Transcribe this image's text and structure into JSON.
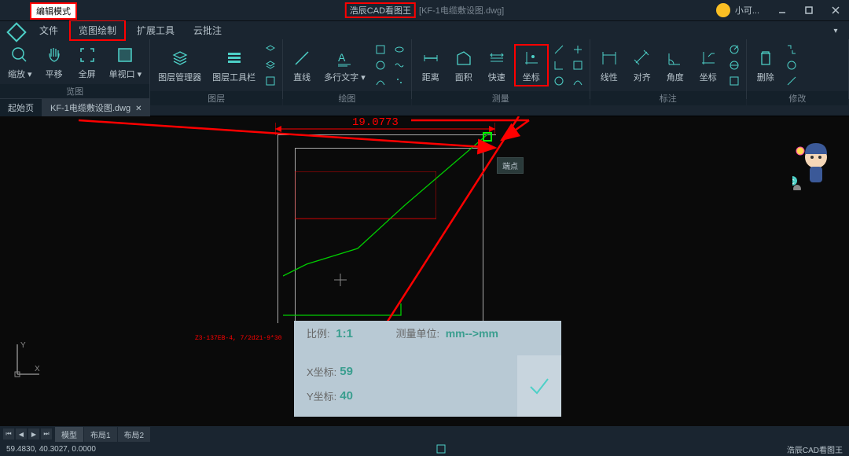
{
  "titlebar": {
    "mode": "编辑模式",
    "app_name": "浩辰CAD看图王",
    "file_name": "[KF-1电缆敷设图.dwg]",
    "user": "小可..."
  },
  "menu": {
    "file": "文件",
    "view_draw": "览图绘制",
    "extend_tools": "扩展工具",
    "cloud_annotate": "云批注"
  },
  "ribbon": {
    "groups": {
      "view": "览图",
      "layer": "图层",
      "draw": "绘图",
      "measure": "测量",
      "annotate": "标注",
      "modify": "修改"
    },
    "buttons": {
      "zoom": "缩放",
      "pan": "平移",
      "fullscreen": "全屏",
      "viewport": "单视口",
      "layer_mgr": "图层管理器",
      "layer_toolbar": "图层工具栏",
      "line": "直线",
      "mtext": "多行文字",
      "distance": "距离",
      "area": "面积",
      "quick": "快速",
      "coord": "坐标",
      "linear": "线性",
      "aligned": "对齐",
      "angle": "角度",
      "coord2": "坐标",
      "delete": "删除"
    }
  },
  "tabs": {
    "start": "起始页",
    "current": "KF-1电缆敷设图.dwg"
  },
  "canvas": {
    "dimension": "19.0773",
    "snap_label": "端点",
    "small_text": "Z3-137EB-4, 7/2d21-9*30"
  },
  "info_panel": {
    "scale_label": "比例:",
    "scale_value": "1:1",
    "unit_label": "测量单位:",
    "unit_value": "mm-->mm",
    "x_label": "X坐标:",
    "x_value": "59",
    "y_label": "Y坐标:",
    "y_value": "40"
  },
  "layout_tabs": {
    "model": "模型",
    "layout1": "布局1",
    "layout2": "布局2"
  },
  "statusbar": {
    "coords": "59.4830, 40.3027, 0.0000",
    "brand": "浩辰CAD看图王"
  },
  "ucs": {
    "x": "X",
    "y": "Y"
  }
}
